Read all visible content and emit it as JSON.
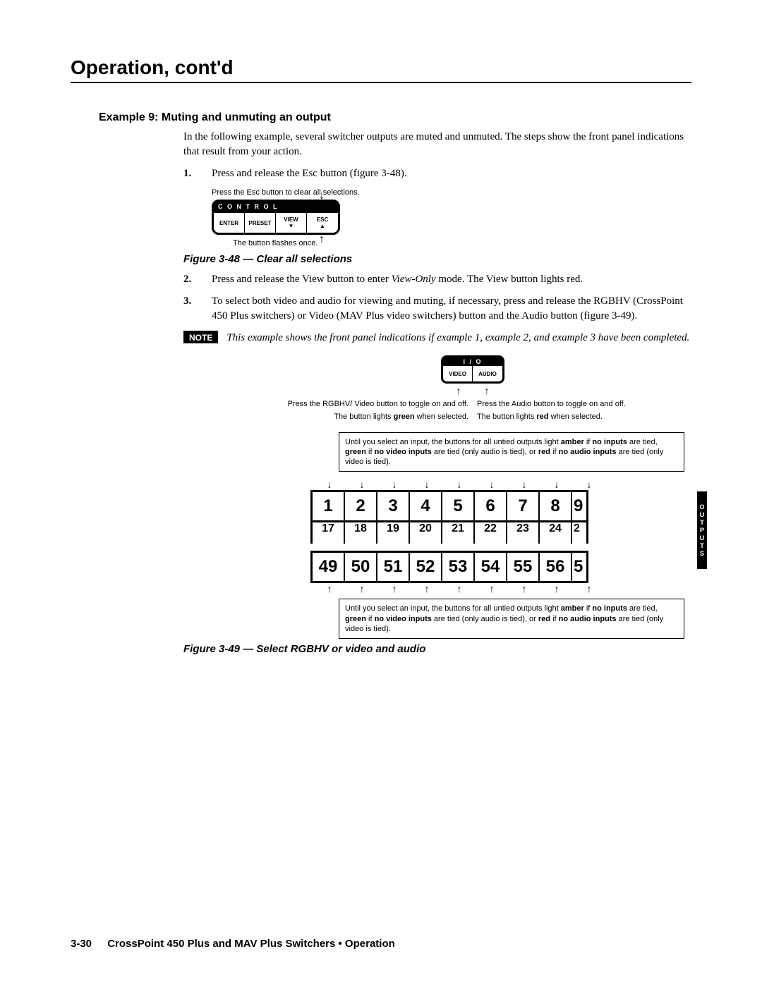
{
  "page_title": "Operation, cont'd",
  "example_heading": "Example 9: Muting and unmuting an output",
  "intro": "In the following example, several switcher outputs are muted and unmuted.  The steps show the front panel indications that result from your action.",
  "steps": {
    "s1_num": "1.",
    "s1_text": "Press and release the Esc button (figure 3-48).",
    "s2_num": "2.",
    "s2_text_a": "Press and release the View button to enter ",
    "s2_text_italic": "View-Only",
    "s2_text_b": " mode.  The View button lights red.",
    "s3_num": "3.",
    "s3_text": "To select both video and audio for viewing and muting, if necessary, press and release the RGBHV (CrossPoint 450 Plus switchers) or Video (MAV Plus video switchers) button and the Audio button (figure 3-49)."
  },
  "fig48": {
    "top_label": "Press the Esc button to clear all selections.",
    "panel_header": "C O N T R O L",
    "btn1": "ENTER",
    "btn2": "PRESET",
    "btn3": "VIEW",
    "btn4": "ESC",
    "bottom_label": "The button flashes once.",
    "caption": "Figure 3-48 — Clear all selections"
  },
  "note": {
    "tag": "NOTE",
    "text": "This example shows the front panel indications if example 1, example 2, and example 3 have been completed."
  },
  "fig49": {
    "io_header": "I / O",
    "btn_video": "VIDEO",
    "btn_audio": "AUDIO",
    "left_line1": "Press the RGBHV/ Video button to toggle on and off.",
    "left_line2a": "The button lights ",
    "left_line2_bold": "green",
    "left_line2b": " when selected.",
    "right_line1": "Press the Audio button to toggle on and off.",
    "right_line2a": "The button lights ",
    "right_line2_bold": "red",
    "right_line2b": " when selected.",
    "legend_a": "Until you select an input, the buttons for all untied outputs light ",
    "legend_amber": "amber",
    "legend_b": " if ",
    "legend_noinputs": "no inputs",
    "legend_c": " are tied, ",
    "legend_green": "green",
    "legend_d": " if ",
    "legend_novideo": "no video inputs",
    "legend_e": " are tied (only audio is tied), or ",
    "legend_red": "red",
    "legend_f": " if ",
    "legend_noaudio": "no audio inputs",
    "legend_g": " are tied (only video is tied).",
    "row1": [
      "1",
      "2",
      "3",
      "4",
      "5",
      "6",
      "7",
      "8",
      "9"
    ],
    "row2": [
      "17",
      "18",
      "19",
      "20",
      "21",
      "22",
      "23",
      "24",
      "2"
    ],
    "row3": [
      "49",
      "50",
      "51",
      "52",
      "53",
      "54",
      "55",
      "56",
      "5"
    ],
    "side_label": "OUTPUTS",
    "caption": "Figure 3-49 — Select RGBHV or video and audio"
  },
  "footer": {
    "page_num": "3-30",
    "text": "CrossPoint 450 Plus and MAV Plus Switchers • Operation"
  }
}
